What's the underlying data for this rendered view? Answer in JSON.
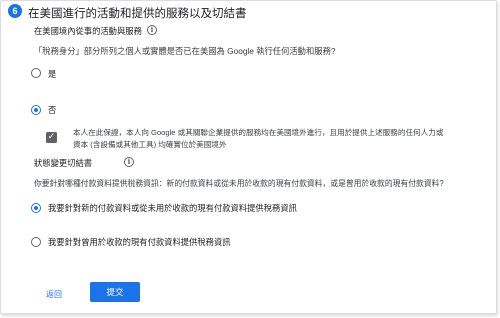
{
  "step": {
    "number": "6",
    "title": "在美國進行的活動和提供的服務以及切結書"
  },
  "section_activities": {
    "heading": "在美國境內從事的活動與服務",
    "question": "「稅務身分」部分所列之個人或實體是否已在美國為 Google 執行任何活動和服務?",
    "options": [
      {
        "label": "是",
        "selected": false
      },
      {
        "label": "否",
        "selected": true
      }
    ],
    "certification": {
      "checked": true,
      "line1": "本人在此保證，本人向 Google 或其關聯企業提供的服務均在美國境外進行，且用於提供上述服務的任何人力或",
      "line2": "資本 (含設備或其他工具) 均確實位於美國境外"
    }
  },
  "section_status": {
    "heading": "狀態變更切結書",
    "question": "你要針對哪種付款資料提供稅務資訊：新的付款資料或從未用於收款的現有付款資料，或是曾用於收款的現有付款資料?",
    "options": [
      {
        "label": "我要針對新的付款資料或從未用於收款的現有付款資料提供稅務資訊",
        "selected": true
      },
      {
        "label": "我要針對曾用於收款的現有付款資料提供稅務資訊",
        "selected": false
      }
    ]
  },
  "actions": {
    "back_label": "返回",
    "submit_label": "提交"
  },
  "colors": {
    "accent": "#1a73e8",
    "text": "#202124",
    "checkbox": "#5f6368"
  },
  "icons": {
    "info": "info-circle-icon",
    "check": "check-icon"
  }
}
